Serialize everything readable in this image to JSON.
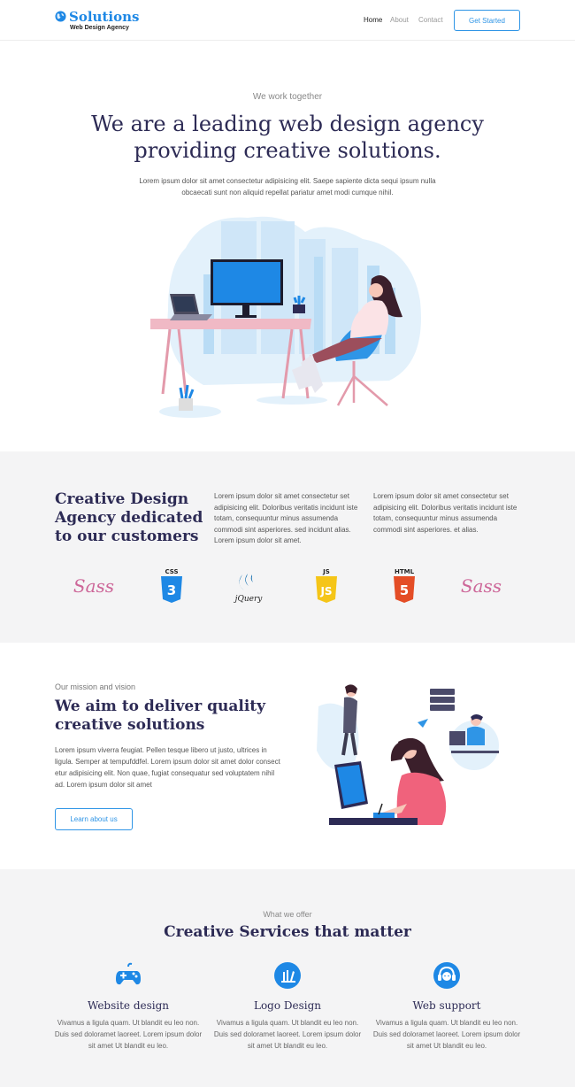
{
  "nav": {
    "brand_name": "Solutions",
    "brand_tagline": "Web Design Agency",
    "links": [
      "Home",
      "About",
      "Contact"
    ],
    "cta": "Get Started"
  },
  "hero": {
    "eyebrow": "We work together",
    "title": "We are a leading web design agency providing creative solutions.",
    "text": "Lorem ipsum dolor sit amet consectetur adipisicing elit. Saepe sapiente dicta sequi ipsum nulla obcaecati sunt non aliquid repellat pariatur amet modi cumque nihil."
  },
  "about": {
    "title": "Creative Design Agency dedicated to our customers",
    "col1": "Lorem ipsum dolor sit amet consectetur set adipisicing elit. Doloribus veritatis incidunt iste totam, consequuntur minus assumenda commodi sint asperiores. sed incidunt alias. Lorem ipsum dolor sit amet.",
    "col2": "Lorem ipsum dolor sit amet consectetur set adipisicing elit. Doloribus veritatis incidunt iste totam, consequuntur minus assumenda commodi sint asperiores. et alias.",
    "logos": [
      "Sass",
      "CSS3",
      "jQuery",
      "JS",
      "HTML5",
      "Sass"
    ]
  },
  "mission": {
    "eyebrow": "Our mission and vision",
    "title": "We aim to deliver quality creative solutions",
    "text": "Lorem ipsum viverra feugiat. Pellen tesque libero ut justo, ultrices in ligula. Semper at tempufddfel. Lorem ipsum dolor sit amet dolor consect etur adipisicing elit. Non quae, fugiat consequatur sed voluptatem nihil ad. Lorem ipsum dolor sit amet",
    "button": "Learn about us"
  },
  "services": {
    "eyebrow": "What we offer",
    "title": "Creative Services that matter",
    "items": [
      {
        "name": "Website design",
        "icon": "gamepad-icon",
        "text": "Vivamus a ligula quam. Ut blandit eu leo non. Duis sed doloramet laoreet. Lorem ipsum dolor sit amet Ut blandit eu leo."
      },
      {
        "name": "Logo Design",
        "icon": "design-icon",
        "text": "Vivamus a ligula quam. Ut blandit eu leo non. Duis sed doloramet laoreet. Lorem ipsum dolor sit amet Ut blandit eu leo."
      },
      {
        "name": "Web support",
        "icon": "headset-icon",
        "text": "Vivamus a ligula quam. Ut blandit eu leo non. Duis sed doloramet laoreet. Lorem ipsum dolor sit amet Ut blandit eu leo."
      }
    ]
  },
  "colors": {
    "brand": "#1e88e5",
    "heading": "#2d2b55",
    "band_bg": "#f4f4f5"
  }
}
